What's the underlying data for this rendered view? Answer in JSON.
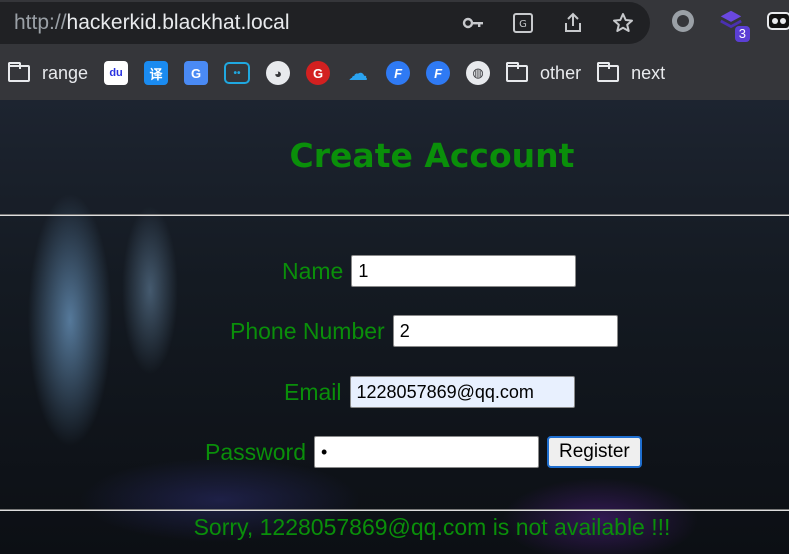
{
  "browser": {
    "url_scheme": "http://",
    "url_host": "hackerkid.blackhat.local",
    "extension_badge": "3",
    "bookmarks": [
      {
        "label": "range",
        "icon": "folder-icon"
      },
      {
        "label": "",
        "icon": "baidu-icon",
        "color": "#2932e1"
      },
      {
        "label": "",
        "icon": "translate-icon",
        "color": "#1a8bf0"
      },
      {
        "label": "",
        "icon": "google-translate-icon",
        "color": "#4a8af4"
      },
      {
        "label": "",
        "icon": "bilibili-icon",
        "color": "#20a8e0"
      },
      {
        "label": "",
        "icon": "github-icon",
        "color": "#e8eaed"
      },
      {
        "label": "",
        "icon": "g-icon",
        "color": "#d32020"
      },
      {
        "label": "",
        "icon": "cloud-icon",
        "color": "#2aa3f0"
      },
      {
        "label": "",
        "icon": "f-icon",
        "color": "#2f7af4"
      },
      {
        "label": "",
        "icon": "f-icon-2",
        "color": "#2f7af4"
      },
      {
        "label": "",
        "icon": "globe-icon",
        "color": "#e8eaed"
      },
      {
        "label": "other",
        "icon": "folder-icon"
      },
      {
        "label": "next",
        "icon": "folder-icon"
      }
    ]
  },
  "page": {
    "title": "Create Account",
    "form": {
      "name_label": "Name",
      "name_value": "1",
      "phone_label": "Phone Number",
      "phone_value": "2",
      "email_label": "Email",
      "email_value": "1228057869@qq.com",
      "password_label": "Password",
      "password_value": "•",
      "register_label": "Register"
    },
    "message": "Sorry, 1228057869@qq.com is not available !!!"
  },
  "colors": {
    "accent_green": "#0a8f0a",
    "button_focus": "#1f6fd0"
  }
}
